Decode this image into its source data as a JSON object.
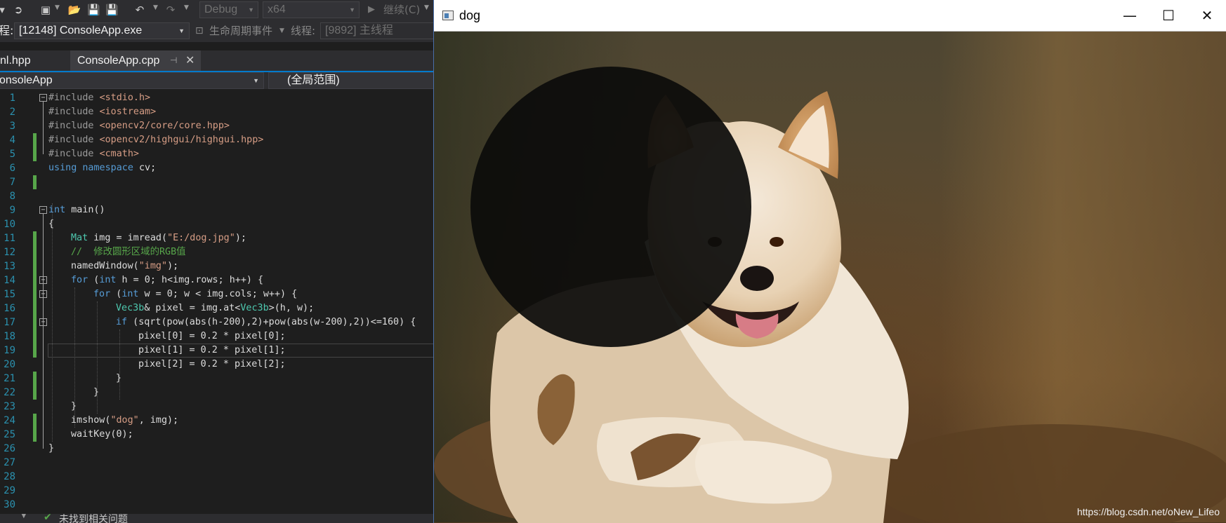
{
  "ide": {
    "toolbar": {
      "config": "Debug",
      "platform": "x64",
      "continue_label": "继续(C)"
    },
    "process_bar": {
      "process_label": "程:",
      "process_value": "[12148] ConsoleApp.exe",
      "lifecycle_label": "生命周期事件",
      "thread_label": "线程:",
      "thread_value": "[9892] 主线程"
    },
    "tabs": [
      {
        "label": "nl.hpp"
      },
      {
        "label": "ConsoleApp.cpp"
      }
    ],
    "nav": {
      "project": "onsoleApp",
      "scope": "(全局范围)"
    },
    "line_numbers": [
      "1",
      "2",
      "3",
      "4",
      "5",
      "6",
      "7",
      "8",
      "9",
      "10",
      "11",
      "12",
      "13",
      "14",
      "15",
      "16",
      "17",
      "18",
      "19",
      "20",
      "21",
      "22",
      "23",
      "24",
      "25",
      "26",
      "27",
      "28",
      "29",
      "30"
    ],
    "code": {
      "l1": {
        "pp": "#include ",
        "inc": "<stdio.h>"
      },
      "l2": {
        "pp": "#include ",
        "inc": "<iostream>"
      },
      "l3": {
        "pp": "#include ",
        "inc": "<opencv2/core/core.hpp>"
      },
      "l4": {
        "pp": "#include ",
        "inc": "<opencv2/highgui/highgui.hpp>"
      },
      "l5": {
        "pp": "#include ",
        "inc": "<cmath>"
      },
      "l6": {
        "kw1": "using",
        "kw2": "namespace",
        "rest": " cv;"
      },
      "l9": {
        "kw": "int",
        "rest": " main()"
      },
      "l10": {
        "text": "{"
      },
      "l11": {
        "ty": "Mat",
        "a": " img = imread(",
        "str": "\"E:/dog.jpg\"",
        "b": ");"
      },
      "l12": {
        "cm": "//  修改圆形区域的RGB值"
      },
      "l13": {
        "a": "namedWindow(",
        "str": "\"img\"",
        "b": ");"
      },
      "l14": {
        "kw": "for",
        "a": " (",
        "kw2": "int",
        "b": " h = 0; h<img.rows; h++) {"
      },
      "l15": {
        "kw": "for",
        "a": " (",
        "kw2": "int",
        "b": " w = 0; w < img.cols; w++) {"
      },
      "l16": {
        "ty": "Vec3b",
        "a": "& pixel = img.at<",
        "ty2": "Vec3b",
        "b": ">(h, w);"
      },
      "l17": {
        "kw": "if",
        "a": " (sqrt(pow(abs(h-200),2)+pow(abs(w-200),2))<=160) {"
      },
      "l18": {
        "text": "pixel[0] = 0.2 * pixel[0];"
      },
      "l19": {
        "text": "pixel[1] = 0.2 * pixel[1];"
      },
      "l20": {
        "text": "pixel[2] = 0.2 * pixel[2];"
      },
      "l21": {
        "text": "}"
      },
      "l22": {
        "text": "}"
      },
      "l23": {
        "text": "}"
      },
      "l24": {
        "a": "imshow(",
        "str": "\"dog\"",
        "b": ", img);"
      },
      "l25": {
        "text": "waitKey(0);"
      },
      "l26": {
        "text": "}"
      }
    },
    "status": {
      "text": "未找到相关问题"
    }
  },
  "window": {
    "title": "dog",
    "minimize": "—",
    "maximize": "☐",
    "close": "✕",
    "watermark": "https://blog.csdn.net/oNew_Lifeo"
  },
  "colors": {
    "ide_bg": "#1e1e1e",
    "accent": "#007acc",
    "change_marker": "#57a64a"
  }
}
